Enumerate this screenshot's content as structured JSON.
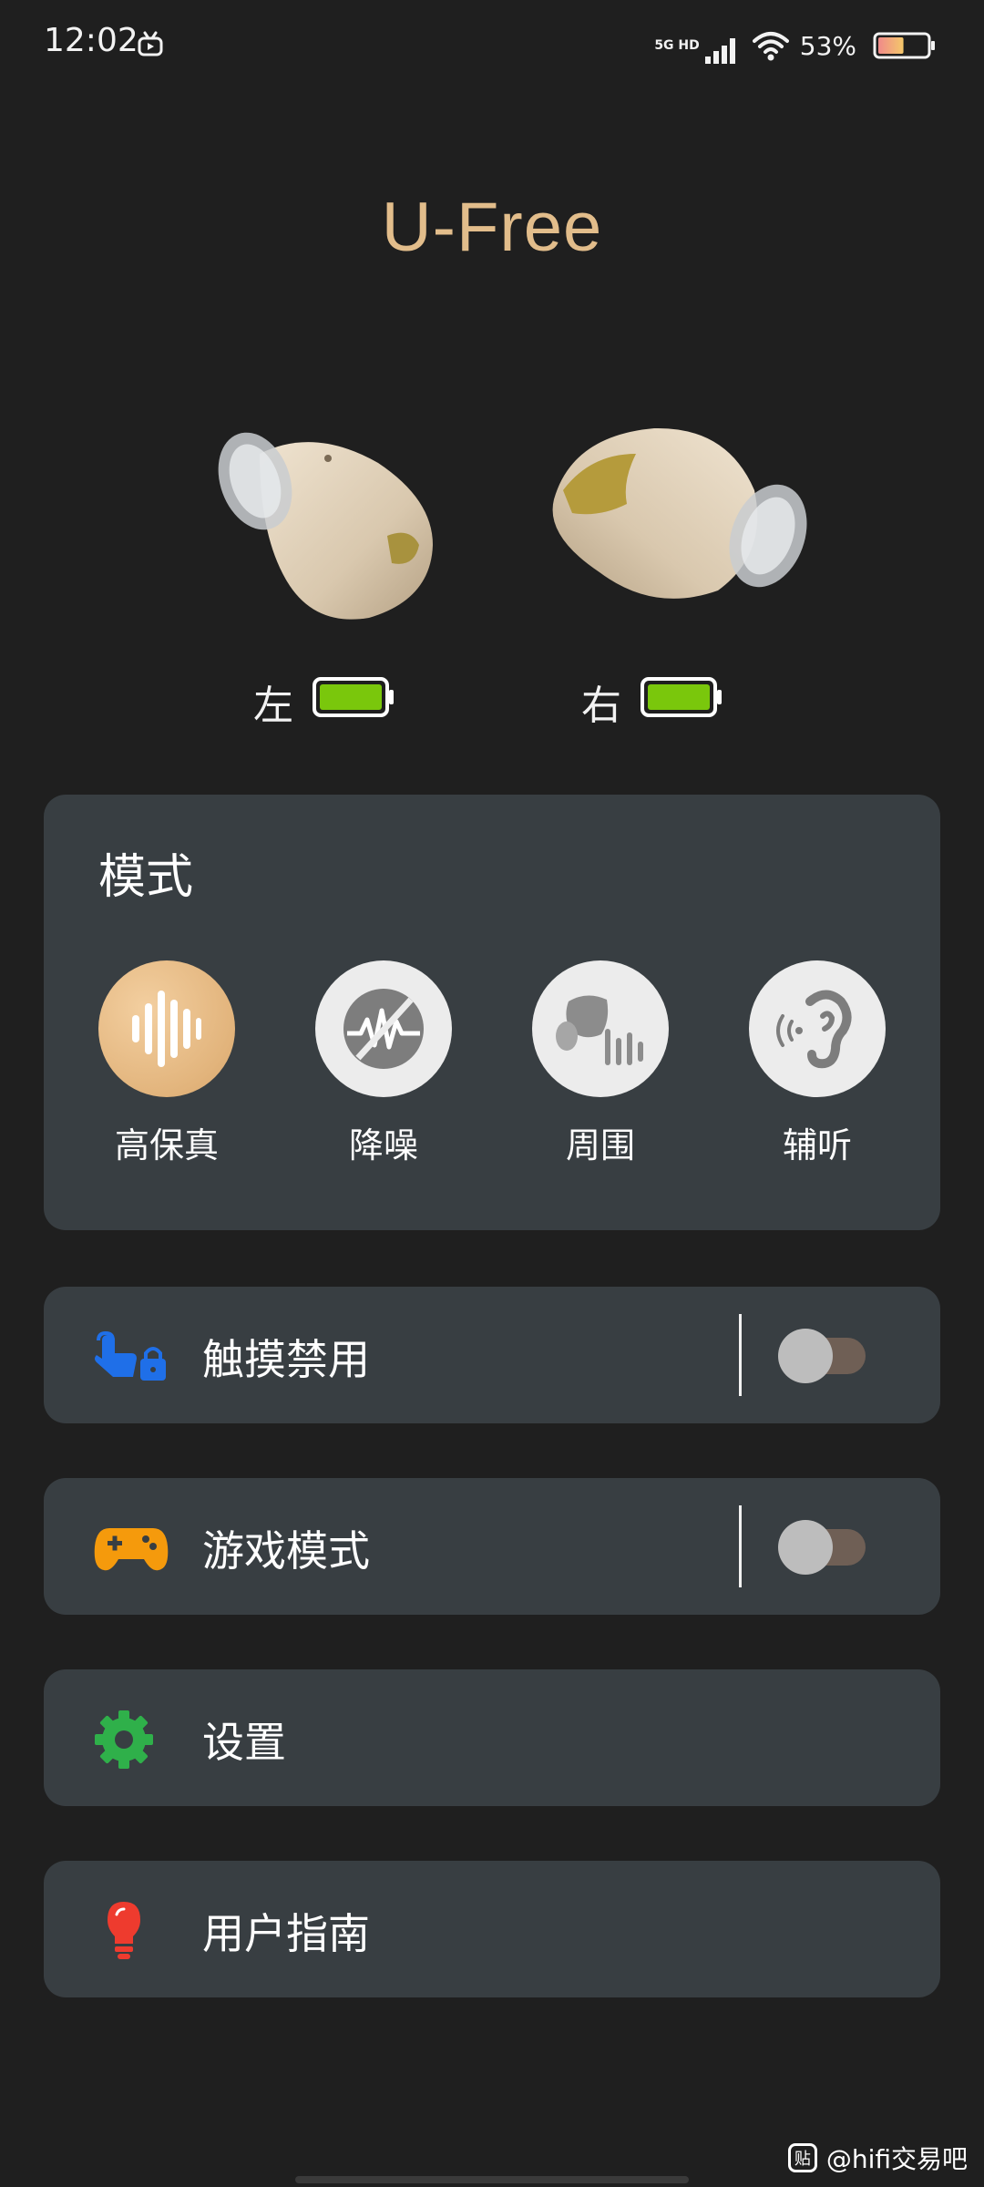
{
  "status_bar": {
    "time": "12:02",
    "network": "5G HD",
    "battery_percent": "53%",
    "battery_level": 0.53,
    "icons": [
      "tv-notification-icon",
      "signal-icon",
      "wifi-icon",
      "battery-icon"
    ]
  },
  "app": {
    "title": "U-Free",
    "title_color": "#e2bd8b"
  },
  "earbuds": {
    "left": {
      "label": "左",
      "battery_color": "#7ac70c",
      "battery_level": 1.0
    },
    "right": {
      "label": "右",
      "battery_color": "#7ac70c",
      "battery_level": 1.0
    }
  },
  "mode": {
    "title": "模式",
    "selected": "高保真",
    "options": [
      {
        "label": "高保真",
        "icon": "soundwave-icon",
        "active": true
      },
      {
        "label": "降噪",
        "icon": "noise-cancel-icon",
        "active": false
      },
      {
        "label": "周围",
        "icon": "ambient-icon",
        "active": false
      },
      {
        "label": "辅听",
        "icon": "hearing-aid-icon",
        "active": false
      }
    ]
  },
  "settings_rows": [
    {
      "label": "触摸禁用",
      "icon": "touch-lock-icon",
      "has_toggle": true,
      "toggle_on": false,
      "icon_color": "#1f6fe8"
    },
    {
      "label": "游戏模式",
      "icon": "gamepad-icon",
      "has_toggle": true,
      "toggle_on": false,
      "icon_color": "#f59a0c"
    },
    {
      "label": "设置",
      "icon": "gear-icon",
      "has_toggle": false,
      "icon_color": "#2fb04a"
    },
    {
      "label": "用户指南",
      "icon": "lightbulb-icon",
      "has_toggle": false,
      "icon_color": "#ee3b2e"
    }
  ],
  "watermark": {
    "icon_text": "贴",
    "text": "@hifi交易吧"
  },
  "colors": {
    "background": "#1f1f1f",
    "card": "#383e42",
    "accent_gold": "#e2b47c"
  }
}
